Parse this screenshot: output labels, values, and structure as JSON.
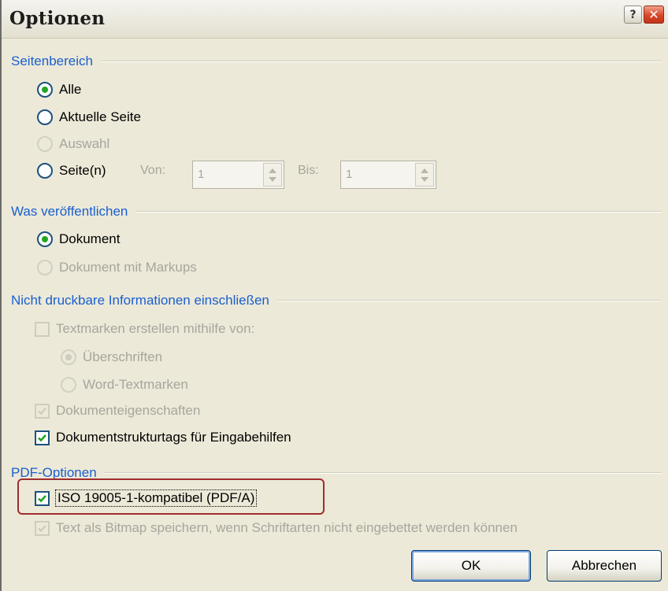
{
  "window": {
    "title": "Optionen",
    "help_label": "?",
    "close_label": "✕"
  },
  "page_range": {
    "title": "Seitenbereich",
    "all": {
      "label": "Alle",
      "selected": true
    },
    "current": {
      "label": "Aktuelle Seite"
    },
    "selection": {
      "label": "Auswahl",
      "disabled": true
    },
    "pages": {
      "label": "Seite(n)",
      "from_label": "Von:",
      "from_value": "1",
      "to_label": "Bis:",
      "to_value": "1"
    }
  },
  "publish": {
    "title": "Was veröffentlichen",
    "document": {
      "label": "Dokument",
      "selected": true
    },
    "document_markups": {
      "label": "Dokument mit Markups",
      "disabled": true
    }
  },
  "nonprint": {
    "title": "Nicht druckbare Informationen einschließen",
    "bookmarks": {
      "label": "Textmarken erstellen mithilfe von:",
      "checked": false,
      "disabled": true
    },
    "headings": {
      "label": "Überschriften",
      "selected": true,
      "disabled": true
    },
    "word_bookmarks": {
      "label": "Word-Textmarken",
      "disabled": true
    },
    "doc_properties": {
      "label": "Dokumenteigenschaften",
      "checked": true,
      "disabled": true
    },
    "structure_tags": {
      "label": "Dokumentstrukturtags für Eingabehilfen",
      "checked": true
    }
  },
  "pdf_options": {
    "title": "PDF-Optionen",
    "iso": {
      "label": "ISO 19005-1-kompatibel (PDF/A)",
      "checked": true
    },
    "bitmap": {
      "label": "Text als Bitmap speichern, wenn Schriftarten nicht eingebettet werden können",
      "checked": true,
      "disabled": true
    }
  },
  "buttons": {
    "ok": "OK",
    "cancel": "Abbrechen"
  },
  "colors": {
    "group_title": "#1a5fd0",
    "check_green": "#24a424",
    "highlight": "#a02d2d"
  }
}
